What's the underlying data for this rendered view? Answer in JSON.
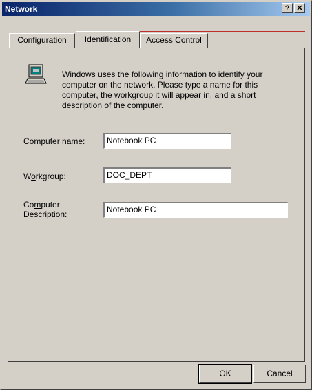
{
  "window": {
    "title": "Network"
  },
  "titlebar": {
    "help_glyph": "?",
    "close_glyph": "✕"
  },
  "tabs": [
    {
      "label": "Configuration",
      "active": false
    },
    {
      "label": "Identification",
      "active": true
    },
    {
      "label": "Access Control",
      "active": false
    }
  ],
  "identification": {
    "icon": "computer-icon",
    "description": "Windows uses the following information to identify your computer on the network.  Please type a name for this computer, the workgroup it will appear in, and a short description of the computer.",
    "computer_name": {
      "label_pre": "",
      "label_ul": "C",
      "label_post": "omputer name:",
      "value": "Notebook PC"
    },
    "workgroup": {
      "label_pre": "W",
      "label_ul": "o",
      "label_post": "rkgroup:",
      "value": "DOC_DEPT"
    },
    "computer_description": {
      "label_line1_pre": "Co",
      "label_line1_ul": "m",
      "label_line1_post": "puter",
      "label_line2": "Description:",
      "value": "Notebook PC"
    }
  },
  "buttons": {
    "ok": "OK",
    "cancel": "Cancel"
  },
  "colors": {
    "title_bar_start": "#0a246a",
    "title_bar_end": "#a6caf0",
    "face": "#d4d0c8",
    "accent_line": "#c0302a"
  }
}
